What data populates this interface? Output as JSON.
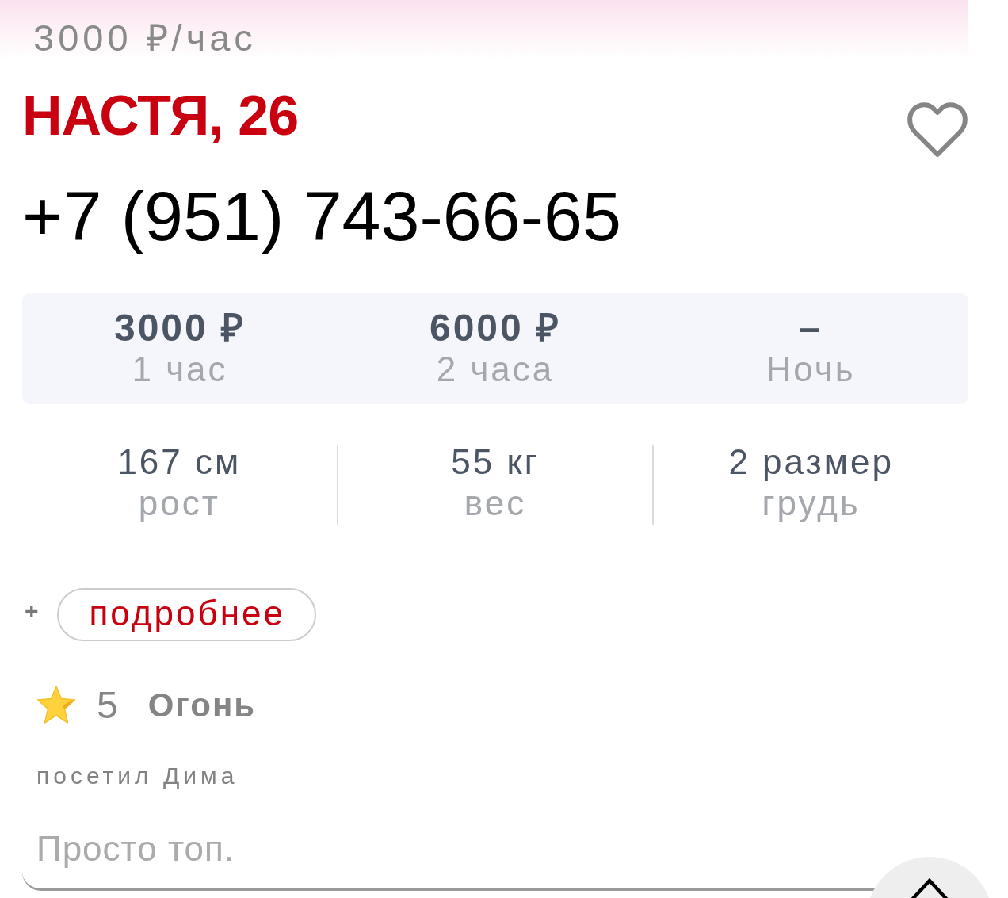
{
  "header": {
    "price": "3000 ₽/час"
  },
  "profile": {
    "name": "НАСТЯ, 26",
    "favorite": false,
    "phone": "+7 (951) 743-66-65"
  },
  "prices": [
    {
      "value": "3000 ₽",
      "label": "1 час"
    },
    {
      "value": "6000 ₽",
      "label": "2 часа"
    },
    {
      "value": "–",
      "label": "Ночь"
    }
  ],
  "stats": [
    {
      "value": "167 см",
      "label": "рост"
    },
    {
      "value": "55 кг",
      "label": "вес"
    },
    {
      "value": "2 размер",
      "label": "грудь"
    }
  ],
  "details": {
    "sign": "+",
    "button": "подробнее"
  },
  "review": {
    "rating": "5",
    "title": "Огонь",
    "author": "посетил Дима",
    "text": "Просто топ."
  }
}
